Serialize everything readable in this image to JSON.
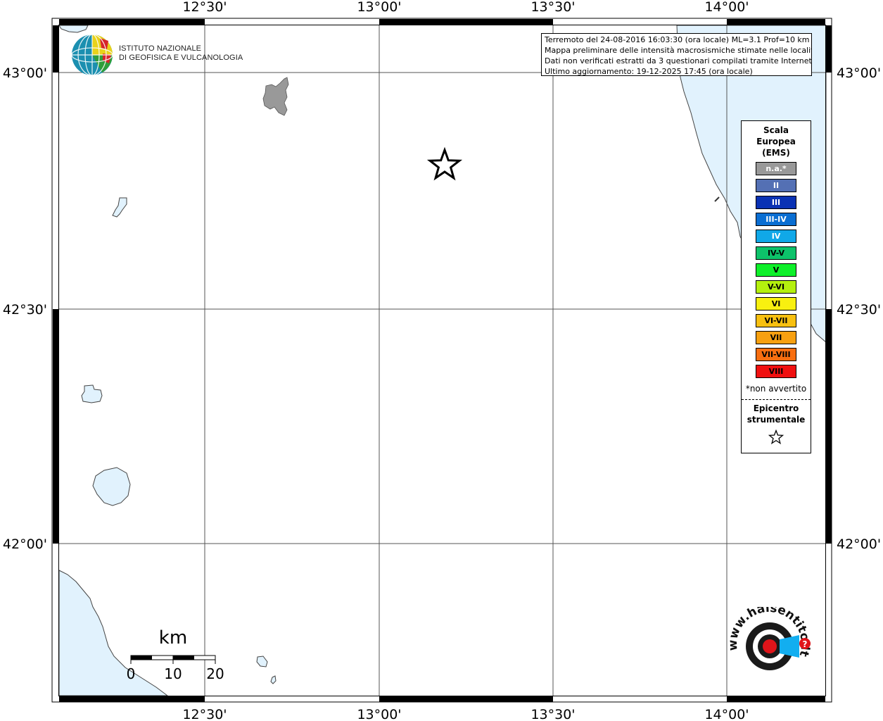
{
  "info": {
    "line1": "Terremoto del 24-08-2016 16:03:30 (ora locale) ML=3.1 Prof=10 km",
    "line2": "Mappa preliminare delle intensità macrosismiche stimate nelle località",
    "line3": "Dati non verificati estratti da 3 questionari compilati tramite Internet.",
    "line4": "Ultimo aggiornamento: 19-12-2025 17:45 (ora locale)"
  },
  "logo": {
    "line1": "ISTITUTO NAZIONALE",
    "line2": "DI GEOFISICA E VULCANOLOGIA"
  },
  "legend": {
    "title1": "Scala",
    "title2": "Europea",
    "title3": "(EMS)",
    "items": [
      {
        "label": "n.a.*",
        "color": "#999999",
        "text": "#ffffff"
      },
      {
        "label": "II",
        "color": "#5470b4",
        "text": "#ffffff"
      },
      {
        "label": "III",
        "color": "#0a32b4",
        "text": "#ffffff"
      },
      {
        "label": "III-IV",
        "color": "#0a6ed2",
        "text": "#ffffff"
      },
      {
        "label": "IV",
        "color": "#10a8e8",
        "text": "#ffffff"
      },
      {
        "label": "IV-V",
        "color": "#0dc26a",
        "text": "#000000"
      },
      {
        "label": "V",
        "color": "#0ef02a",
        "text": "#000000"
      },
      {
        "label": "V-VI",
        "color": "#b4f00e",
        "text": "#000000"
      },
      {
        "label": "VI",
        "color": "#f8f010",
        "text": "#000000"
      },
      {
        "label": "VI-VII",
        "color": "#f8c010",
        "text": "#000000"
      },
      {
        "label": "VII",
        "color": "#f8a010",
        "text": "#000000"
      },
      {
        "label": "VII-VIII",
        "color": "#f86e10",
        "text": "#000000"
      },
      {
        "label": "VIII",
        "color": "#f01010",
        "text": "#000000"
      }
    ],
    "note": "*non avvertito",
    "epi1": "Epicentro",
    "epi2": "strumentale"
  },
  "scale": {
    "unit": "km",
    "ticks": [
      "0",
      "10",
      "20"
    ]
  },
  "axes": {
    "lon": [
      "12°30'",
      "13°00'",
      "13°30'",
      "14°00'"
    ],
    "lat": [
      "43°00'",
      "42°30'",
      "42°00'"
    ]
  },
  "watermark": "www.haisentitoilterremoto.it",
  "colors": {
    "sea": "#e1f2fd",
    "town": "#999999"
  }
}
